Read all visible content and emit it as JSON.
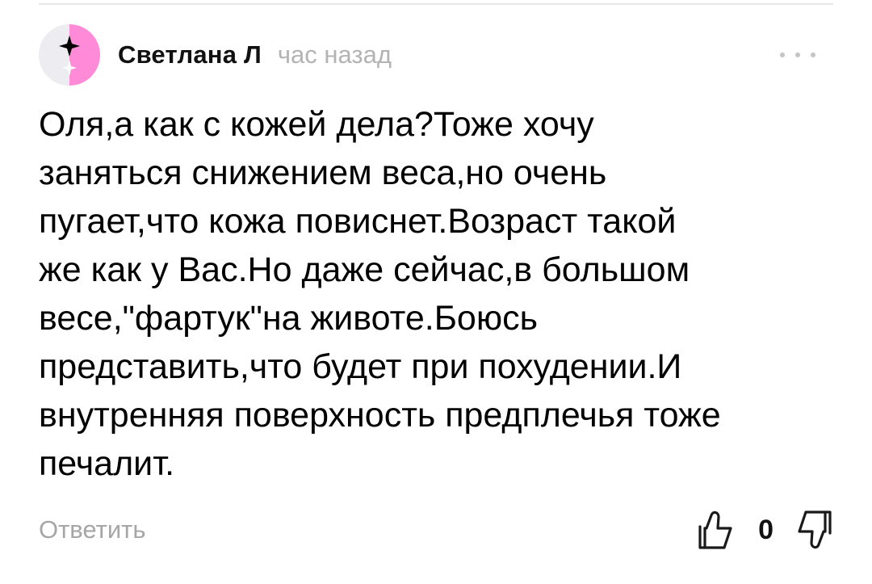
{
  "comment": {
    "author": "Светлана Л",
    "time": "час назад",
    "text": "Оля,а как с кожей дела?Тоже хочу\nзаняться снижением веса,но очень\nпугает,что кожа повиснет.Возраст такой\nже как у Вас.Но даже сейчас,в большом\nвесе,\"фартук\"на животе.Боюсь\nпредставить,что будет при похудении.И\nвнутренняя поверхность предплечья тоже\nпечалит.",
    "reply_label": "Ответить",
    "like_count": "0"
  },
  "icons": {
    "avatar": "sparkle-avatar-icon",
    "more": "more-dots-icon",
    "like": "thumb-up-icon",
    "dislike": "thumb-down-icon"
  },
  "colors": {
    "avatar_pink": "#ff8ad8",
    "avatar_bg": "#ececf1",
    "muted_text": "#a6a6a6"
  }
}
